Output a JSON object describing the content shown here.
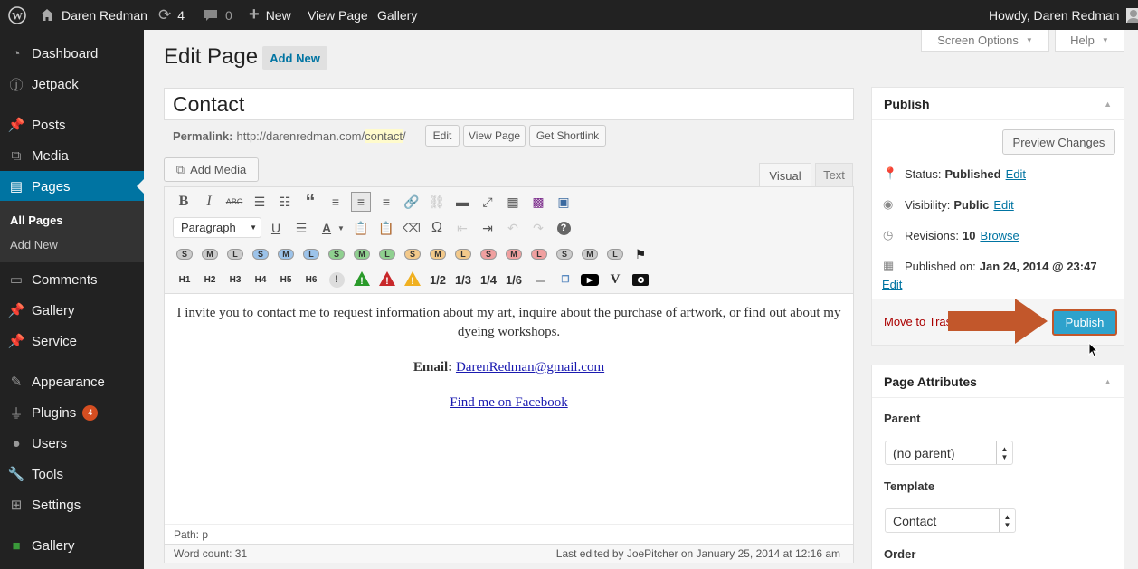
{
  "adminbar": {
    "site": "Daren Redman",
    "updates": "4",
    "comments": "0",
    "new": "New",
    "view_page": "View Page",
    "gallery": "Gallery",
    "howdy": "Howdy, Daren Redman"
  },
  "sidebar": {
    "items": [
      {
        "label": "Dashboard",
        "icon": "dashboard-icon"
      },
      {
        "label": "Jetpack",
        "icon": "jetpack-icon"
      },
      {
        "label": "Posts",
        "icon": "pushpin-icon"
      },
      {
        "label": "Media",
        "icon": "media-icon"
      },
      {
        "label": "Pages",
        "icon": "pages-icon"
      },
      {
        "label": "Comments",
        "icon": "comment-icon"
      },
      {
        "label": "Gallery",
        "icon": "pushpin-icon"
      },
      {
        "label": "Service",
        "icon": "pushpin-icon"
      },
      {
        "label": "Appearance",
        "icon": "brush-icon"
      },
      {
        "label": "Plugins",
        "icon": "plug-icon",
        "badge": "4"
      },
      {
        "label": "Users",
        "icon": "user-icon"
      },
      {
        "label": "Tools",
        "icon": "wrench-icon"
      },
      {
        "label": "Settings",
        "icon": "settings-icon"
      },
      {
        "label": "Gallery",
        "icon": "gallery-icon"
      }
    ],
    "sub": {
      "all_pages": "All Pages",
      "add_new": "Add New"
    }
  },
  "header": {
    "title": "Edit Page",
    "add_new": "Add New",
    "screen_options": "Screen Options",
    "help": "Help"
  },
  "editor": {
    "title_value": "Contact",
    "permalink_label": "Permalink:",
    "permalink_base": "http://darenredman.com/",
    "permalink_slug": "contact",
    "permalink_end": "/",
    "edit": "Edit",
    "view_page": "View Page",
    "get_shortlink": "Get Shortlink",
    "add_media": "Add Media",
    "tab_visual": "Visual",
    "tab_text": "Text",
    "format_select": "Paragraph",
    "headings": [
      "H1",
      "H2",
      "H3",
      "H4",
      "H5",
      "H6"
    ],
    "fractions": [
      "1/2",
      "1/3",
      "1/4",
      "1/6"
    ],
    "shortcodes": [
      "S",
      "M",
      "L",
      "S",
      "M",
      "L",
      "S",
      "M",
      "L",
      "S",
      "M",
      "L",
      "S",
      "M",
      "L",
      "S",
      "M",
      "L"
    ],
    "content_p1": "I invite you to contact me to request information about my art, inquire about the purchase of artwork, or find out about my dyeing workshops.",
    "email_label": "Email:",
    "email": "DarenRedman@gmail.com",
    "facebook": "Find me on Facebook",
    "path": "Path: p",
    "word_count": "Word count: 31",
    "last_edited": "Last edited by JoePitcher on January 25, 2014 at 12:16 am"
  },
  "publish": {
    "title": "Publish",
    "preview": "Preview Changes",
    "status_label": "Status:",
    "status": "Published",
    "visibility_label": "Visibility:",
    "visibility": "Public",
    "revisions_label": "Revisions:",
    "revisions": "10",
    "browse": "Browse",
    "published_on_label": "Published on:",
    "published_on": "Jan 24, 2014 @ 23:47",
    "edit": "Edit",
    "move_to_trash": "Move to Trash",
    "publish_button": "Publish"
  },
  "attributes": {
    "title": "Page Attributes",
    "parent_label": "Parent",
    "parent_value": "(no parent)",
    "template_label": "Template",
    "template_value": "Contact",
    "order_label": "Order"
  },
  "colors": {
    "accent": "#0074a2",
    "admin_bg": "#222222",
    "arrow": "#c2572b",
    "publish_btn": "#2ea2cc"
  }
}
